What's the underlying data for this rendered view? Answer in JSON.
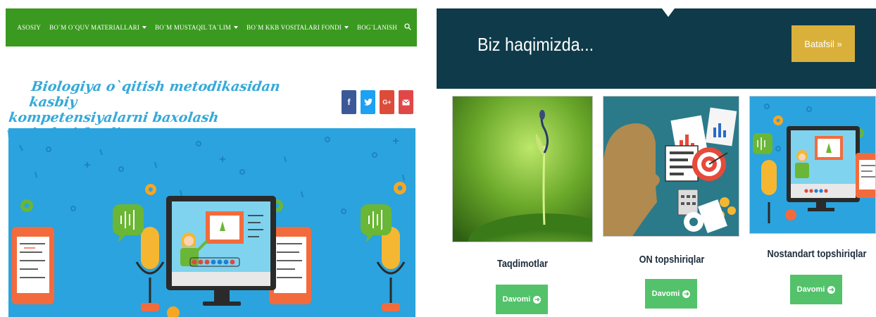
{
  "nav": {
    "items": [
      {
        "label": "ASOSIY",
        "has_dropdown": false
      },
      {
        "label": "BO`M O`QUV MATERIALLARI",
        "has_dropdown": true
      },
      {
        "label": "BO`M MUSTAQIL TA`LIM",
        "has_dropdown": true
      },
      {
        "label": "BO`M KKB VOSITALARI FONDI",
        "has_dropdown": true
      },
      {
        "label": "BOG`LANISH",
        "has_dropdown": false
      }
    ],
    "search_icon": "search-icon",
    "bar_color": "#3a9a1f"
  },
  "site": {
    "title_line1": "Biologiya o`qitish metodikasidan kasbiy",
    "title_line2": "kompetensiyalarni baxolash vositalari fondi",
    "title_color": "#36a9d9"
  },
  "social": [
    {
      "icon": "facebook-icon",
      "glyph": "f",
      "color": "#3b5998"
    },
    {
      "icon": "twitter-icon",
      "glyph": "🐦",
      "color": "#1da1f2"
    },
    {
      "icon": "google-plus-icon",
      "glyph": "G+",
      "color": "#dd4b39"
    },
    {
      "icon": "mail-icon",
      "glyph": "✉",
      "color": "#e04848"
    }
  ],
  "about": {
    "title": "Biz haqimizda...",
    "more_label": "Batafsil »",
    "banner_color": "#0f3a4a",
    "button_color": "#d9b13a"
  },
  "cards": [
    {
      "title": "Taqdimotlar",
      "button": "Davomi"
    },
    {
      "title": "ON topshiriqlar",
      "button": "Davomi"
    },
    {
      "title": "Nostandart topshiriqlar",
      "button": "Davomi"
    }
  ]
}
